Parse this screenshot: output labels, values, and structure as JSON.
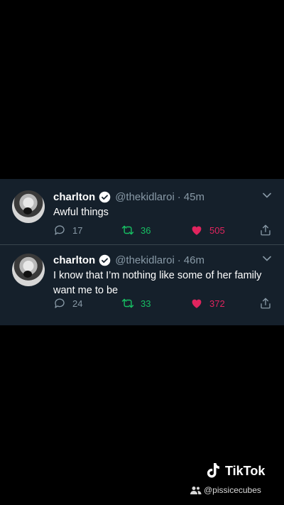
{
  "tweets": [
    {
      "name": "charlton",
      "handle": "@thekidlaroi",
      "separator": "·",
      "time": "45m",
      "text": "Awful things",
      "replies": "17",
      "retweets": "36",
      "likes": "505"
    },
    {
      "name": "charlton",
      "handle": "@thekidlaroi",
      "separator": "·",
      "time": "46m",
      "text": "I know that I’m nothing like some of her family want me to be",
      "replies": "24",
      "retweets": "33",
      "likes": "372"
    }
  ],
  "watermark": {
    "brand": "TikTok",
    "user": "@pissicecubes"
  },
  "colors": {
    "background": "#000000",
    "card": "#15202b",
    "muted": "#8899a6",
    "retweet": "#17bf63",
    "like": "#e0245e",
    "verified": "#ffffff"
  }
}
